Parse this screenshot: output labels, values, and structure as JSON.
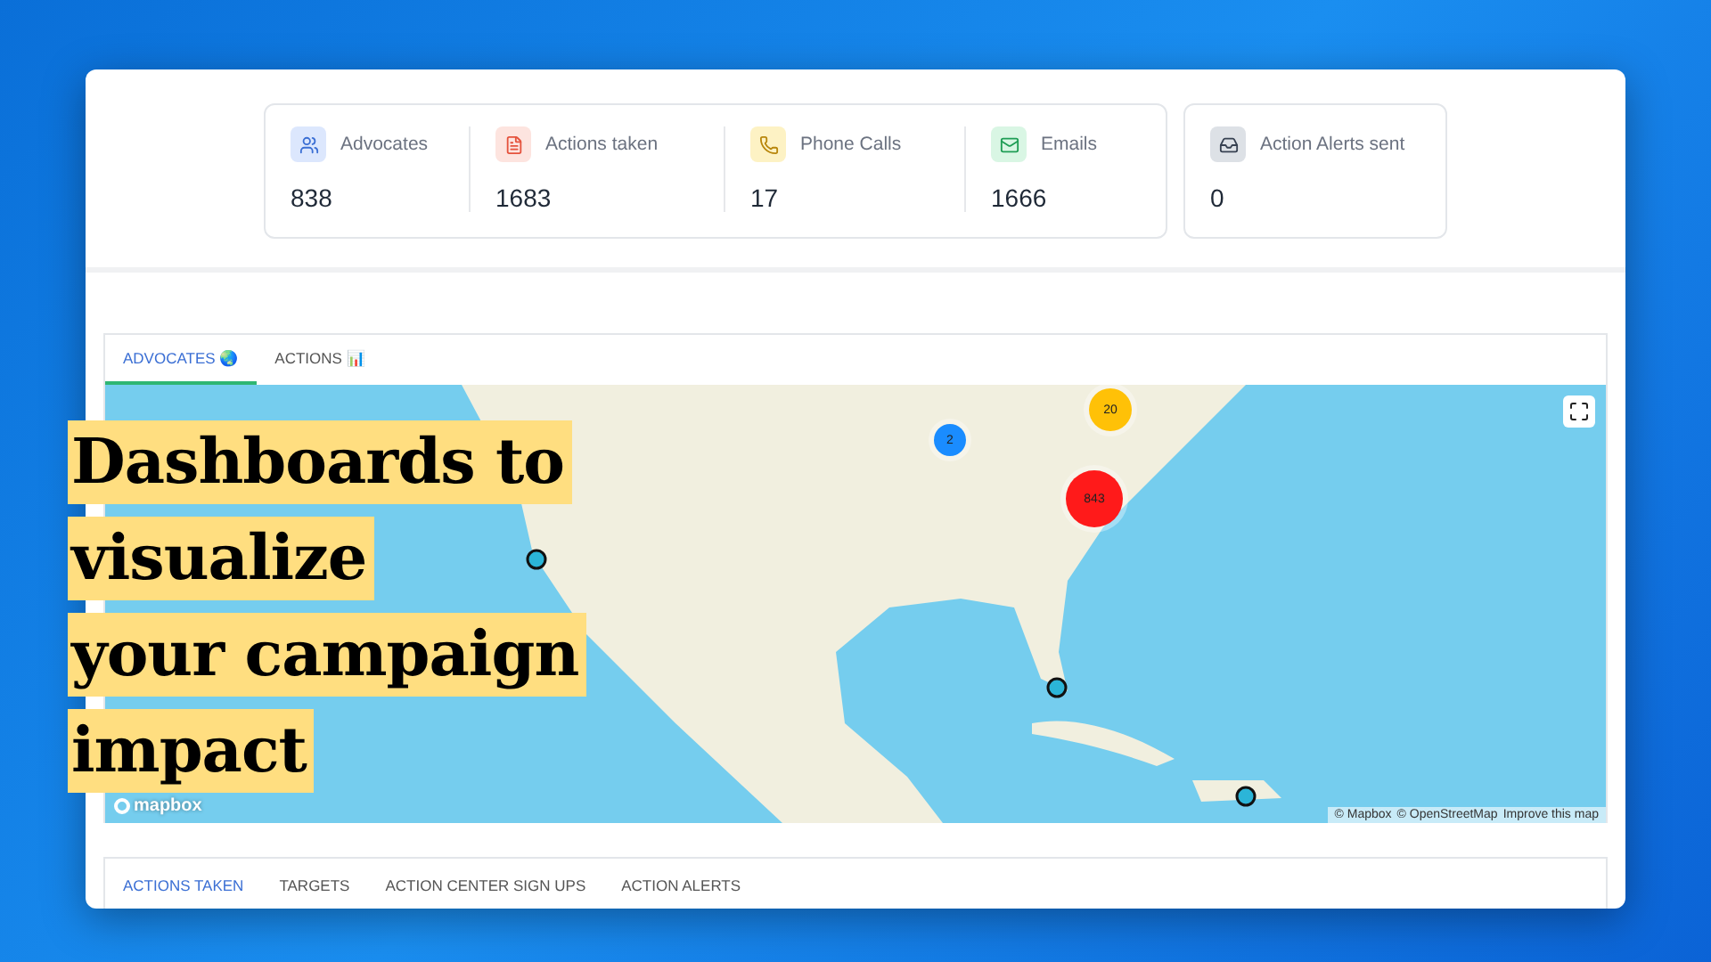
{
  "stats": [
    {
      "label": "Advocates",
      "value": "838",
      "color": "#dce7fd"
    },
    {
      "label": "Actions taken",
      "value": "1683",
      "color": "#fde4df"
    },
    {
      "label": "Phone Calls",
      "value": "17",
      "color": "#fdf2c4"
    },
    {
      "label": "Emails",
      "value": "1666",
      "color": "#d9f6e4"
    }
  ],
  "alerts": {
    "label": "Action Alerts sent",
    "value": "0",
    "color": "#dde1e6"
  },
  "map_tabs": [
    {
      "label": "ADVOCATES 🌏",
      "selected": true
    },
    {
      "label": "ACTIONS 📊",
      "selected": false
    }
  ],
  "map": {
    "clusters": [
      {
        "count": "2",
        "color": "#1a8cff"
      },
      {
        "count": "20",
        "color": "#ffc107"
      },
      {
        "count": "843",
        "color": "#ff1a1a"
      }
    ],
    "logo": "mapbox",
    "attribution": [
      "© Mapbox",
      "© OpenStreetMap"
    ],
    "improve_link": "Improve this map"
  },
  "headline": [
    "Dashboards to",
    "visualize",
    "your campaign",
    "impact"
  ],
  "bottom_tabs": [
    {
      "label": "ACTIONS TAKEN",
      "selected": true
    },
    {
      "label": "TARGETS",
      "selected": false
    },
    {
      "label": "ACTION CENTER SIGN UPS",
      "selected": false
    },
    {
      "label": "ACTION ALERTS",
      "selected": false
    }
  ]
}
